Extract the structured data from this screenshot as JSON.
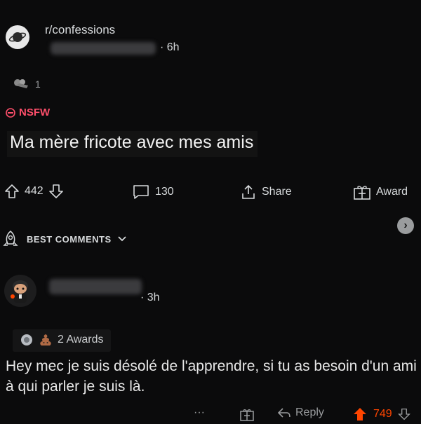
{
  "post": {
    "subreddit": "r/confessions",
    "time": "· 6h",
    "award_count": "1",
    "nsfw_label": "NSFW",
    "title": "Ma mère fricote avec mes amis"
  },
  "actions": {
    "upvotes": "442",
    "comments": "130",
    "share": "Share",
    "award": "Award"
  },
  "sort": {
    "label": "BEST COMMENTS"
  },
  "comment": {
    "time": "· 3h",
    "awards": "2 Awards",
    "body": "Hey mec je suis désolé de l'apprendre, si tu as besoin d'un ami à qui parler je suis là.",
    "more": "···",
    "reply": "Reply",
    "votes": "749"
  },
  "colors": {
    "background": "#0b0b0c",
    "nsfw": "#ff4f6b",
    "upvote_active": "#ff4500"
  }
}
